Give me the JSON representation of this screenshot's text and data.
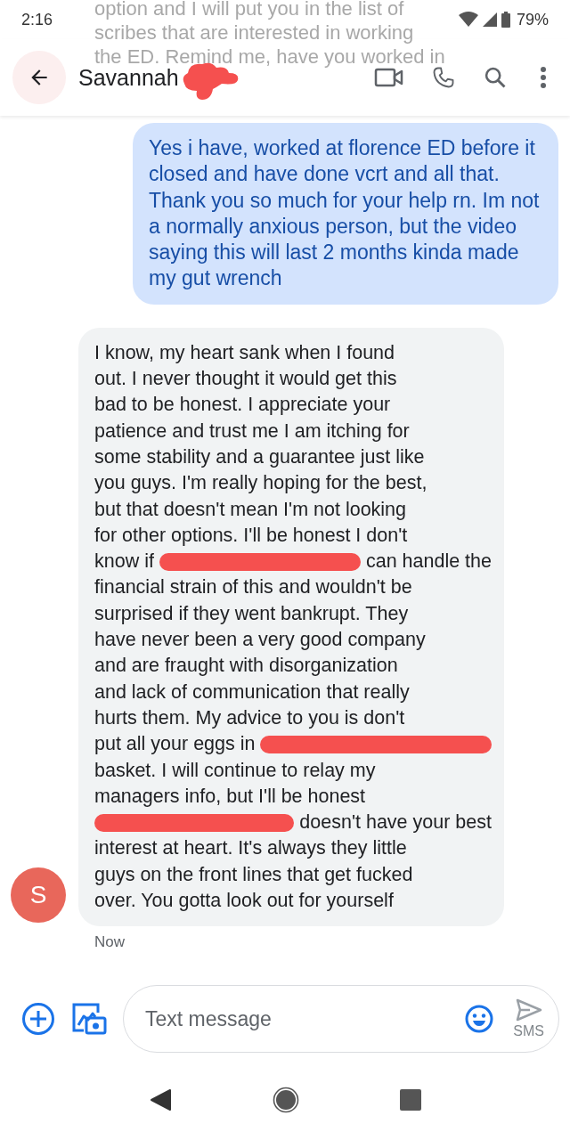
{
  "status_bar": {
    "time": "2:16",
    "battery": "79%"
  },
  "faded_message": {
    "lines": [
      "option and I will put you in the list of",
      "scribes that are interested in working",
      "the ED. Remind me, have you worked in"
    ]
  },
  "header": {
    "title": "Savannah",
    "title_redacted": true
  },
  "messages": [
    {
      "kind": "outgoing",
      "segments": [
        {
          "kind": "text",
          "text": "Yes i have, worked at florence ED before it closed and have done vcrt and all that. Thank you so much for your help rn. Im not a normally anxious person, but the video saying this will last 2 months kinda made my gut wrench"
        }
      ]
    },
    {
      "kind": "incoming",
      "avatar": "S",
      "time": "Now",
      "lines": [
        [
          {
            "kind": "text",
            "text": "I know, my heart sank when I found"
          }
        ],
        [
          {
            "kind": "text",
            "text": "out. I never thought it would get this"
          }
        ],
        [
          {
            "kind": "text",
            "text": "bad to be honest. I appreciate your"
          }
        ],
        [
          {
            "kind": "text",
            "text": "patience and trust me I am itching for"
          }
        ],
        [
          {
            "kind": "text",
            "text": "some stability and a guarantee just like"
          }
        ],
        [
          {
            "kind": "text",
            "text": "you guys. I'm really hoping for the best,"
          }
        ],
        [
          {
            "kind": "text",
            "text": "but that doesn't mean I'm not looking"
          }
        ],
        [
          {
            "kind": "text",
            "text": "for other options. I'll be honest I don't"
          }
        ],
        [
          {
            "kind": "text",
            "text": "know if"
          },
          {
            "kind": "redaction"
          },
          {
            "kind": "text",
            "text": "can handle the"
          }
        ],
        [
          {
            "kind": "text",
            "text": "financial strain of this and wouldn't be"
          }
        ],
        [
          {
            "kind": "text",
            "text": "surprised if they went bankrupt. They"
          }
        ],
        [
          {
            "kind": "text",
            "text": "have never been a very good company"
          }
        ],
        [
          {
            "kind": "text",
            "text": "and are fraught with disorganization"
          }
        ],
        [
          {
            "kind": "text",
            "text": "and lack of communication that really"
          }
        ],
        [
          {
            "kind": "text",
            "text": "hurts them. My advice to you is don't"
          }
        ],
        [
          {
            "kind": "text",
            "text": "put all your eggs in"
          },
          {
            "kind": "redaction"
          }
        ],
        [
          {
            "kind": "text",
            "text": "basket. I will continue to relay my"
          }
        ],
        [
          {
            "kind": "text",
            "text": "managers info, but I'll be honest"
          }
        ],
        [
          {
            "kind": "redaction"
          },
          {
            "kind": "text",
            "text": "doesn't have your best"
          }
        ],
        [
          {
            "kind": "text",
            "text": "interest at heart. It's always they little"
          }
        ],
        [
          {
            "kind": "text",
            "text": "guys on the front lines that get fucked"
          }
        ],
        [
          {
            "kind": "text",
            "text": "over. You gotta look out for yourself"
          }
        ]
      ]
    }
  ],
  "compose": {
    "placeholder": "Text message",
    "send_label": "SMS"
  }
}
